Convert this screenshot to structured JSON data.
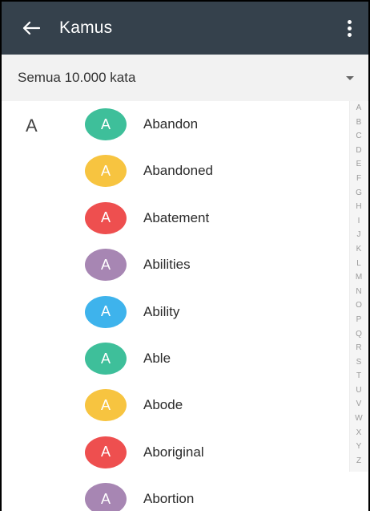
{
  "appbar": {
    "title": "Kamus",
    "back_icon": "arrow-left-icon",
    "menu_icon": "more-vert-icon"
  },
  "filter": {
    "selected": "Semua 10.000 kata"
  },
  "section_letter": "A",
  "colors": {
    "appbar": "#35414c",
    "teal": "#3ebf9a",
    "yellow": "#f7c440",
    "red": "#ee4f4f",
    "purple": "#a786b3",
    "blue": "#3eb3ec"
  },
  "words": [
    {
      "initial": "A",
      "word": "Abandon",
      "color": "#3ebf9a"
    },
    {
      "initial": "A",
      "word": "Abandoned",
      "color": "#f7c440"
    },
    {
      "initial": "A",
      "word": "Abatement",
      "color": "#ee4f4f"
    },
    {
      "initial": "A",
      "word": "Abilities",
      "color": "#a786b3"
    },
    {
      "initial": "A",
      "word": "Ability",
      "color": "#3eb3ec"
    },
    {
      "initial": "A",
      "word": "Able",
      "color": "#3ebf9a"
    },
    {
      "initial": "A",
      "word": "Abode",
      "color": "#f7c440"
    },
    {
      "initial": "A",
      "word": "Aboriginal",
      "color": "#ee4f4f"
    },
    {
      "initial": "A",
      "word": "Abortion",
      "color": "#a786b3"
    }
  ],
  "index": [
    "A",
    "B",
    "C",
    "D",
    "E",
    "F",
    "G",
    "H",
    "I",
    "J",
    "K",
    "L",
    "M",
    "N",
    "O",
    "P",
    "Q",
    "R",
    "S",
    "T",
    "U",
    "V",
    "W",
    "X",
    "Y",
    "Z"
  ]
}
